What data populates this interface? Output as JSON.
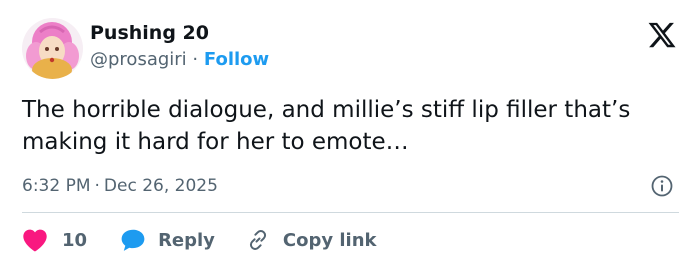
{
  "author": {
    "display_name": "Pushing 20",
    "handle": "@prosagiri",
    "separator": "·",
    "follow_label": "Follow"
  },
  "tweet": {
    "text": "The horrible dialogue, and millie’s stiff lip filler that’s making it hard for her to emote…",
    "time": "6:32 PM",
    "date_separator": "·",
    "date": "Dec 26, 2025"
  },
  "actions": {
    "likes_count": "10",
    "reply_label": "Reply",
    "copy_link_label": "Copy link"
  },
  "icons": {
    "brand": "x-logo-icon",
    "info": "info-icon",
    "like": "heart-icon",
    "reply": "speech-bubble-icon",
    "copy": "link-icon"
  },
  "colors": {
    "text_primary": "#0f1419",
    "text_secondary": "#536471",
    "accent": "#1d9bf0",
    "like": "#f91880",
    "divider": "#cfd9de"
  }
}
